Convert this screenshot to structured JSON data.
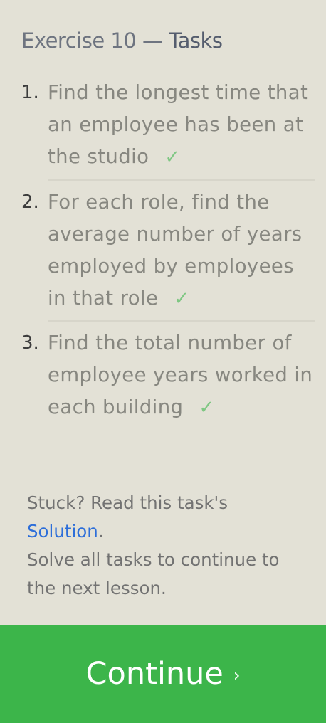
{
  "header": {
    "exercise": "Exercise 10",
    "separator": "—",
    "tasks_label": "Tasks"
  },
  "tasks": [
    {
      "number": "1.",
      "text": "Find the longest time that an employee has been at the studio",
      "completed": true,
      "check": "✓"
    },
    {
      "number": "2.",
      "text": "For each role, find the average number of years employed by employees in that role",
      "completed": true,
      "check": "✓"
    },
    {
      "number": "3.",
      "text": "Find the total number of employee years worked in each building",
      "completed": true,
      "check": "✓"
    }
  ],
  "help": {
    "stuck_text": "Stuck? Read this task's",
    "solution_link": "Solution",
    "period": ".",
    "instruction": "Solve all tasks to continue to the next lesson."
  },
  "continue_button": {
    "label": "Continue",
    "chevron": "›"
  },
  "colors": {
    "background": "#e3e1d6",
    "check": "#7fc783",
    "link": "#2d6ed9",
    "button": "#3cb54a"
  }
}
